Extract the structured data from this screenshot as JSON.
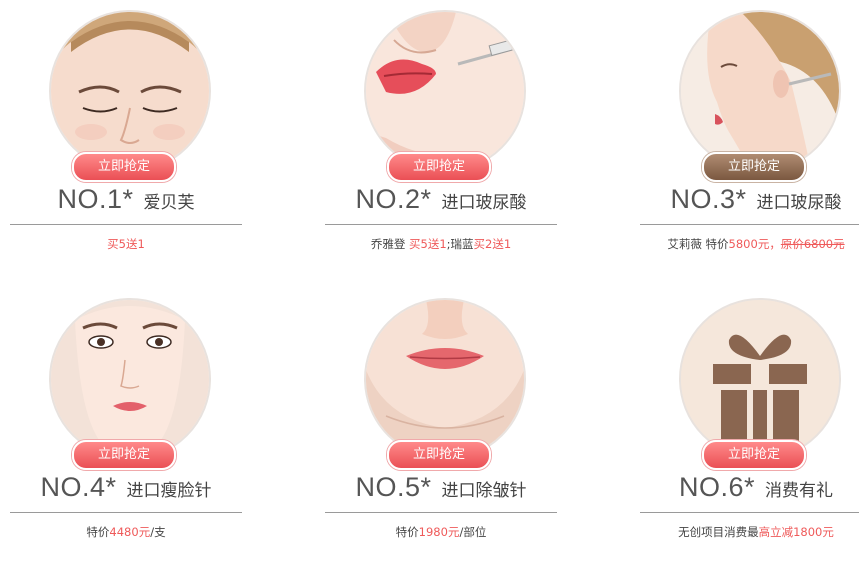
{
  "button_label": "立即抢定",
  "products": [
    {
      "no": "NO.1*",
      "name": "爱贝芙",
      "desc": {
        "prefix": "",
        "red": "买5送1",
        "mid": "",
        "red2": "",
        "strike": ""
      }
    },
    {
      "no": "NO.2*",
      "name": "进口玻尿酸",
      "desc": {
        "prefix": "乔雅登 ",
        "red": "买5送1",
        "mid": ";瑞蓝",
        "red2": "买2送1",
        "strike": ""
      }
    },
    {
      "no": "NO.3*",
      "name": "进口玻尿酸",
      "desc": {
        "prefix": "艾莉薇 特价",
        "red": "5800元，",
        "mid": "",
        "red2": "",
        "strike": "原价6800元"
      }
    },
    {
      "no": "NO.4*",
      "name": "进口瘦脸针",
      "desc": {
        "prefix": "特价",
        "red": "4480元",
        "mid": "/支",
        "red2": "",
        "strike": ""
      }
    },
    {
      "no": "NO.5*",
      "name": "进口除皱针",
      "desc": {
        "prefix": "特价",
        "red": "1980元",
        "mid": "/部位",
        "red2": "",
        "strike": ""
      }
    },
    {
      "no": "NO.6*",
      "name": "消费有礼",
      "desc": {
        "prefix": "无创项目消费最",
        "red": "高立减1800元",
        "mid": "",
        "red2": "",
        "strike": ""
      }
    }
  ],
  "colors": {
    "badge_red": "#ea4f55",
    "badge_brown": "#7b5840",
    "accent_red": "#ef5a5a"
  },
  "icons": [
    "face-eyes-closed-illustration",
    "lips-injection-illustration",
    "profile-ear-injection-illustration",
    "full-face-illustration",
    "lips-chin-illustration",
    "gift-icon"
  ]
}
